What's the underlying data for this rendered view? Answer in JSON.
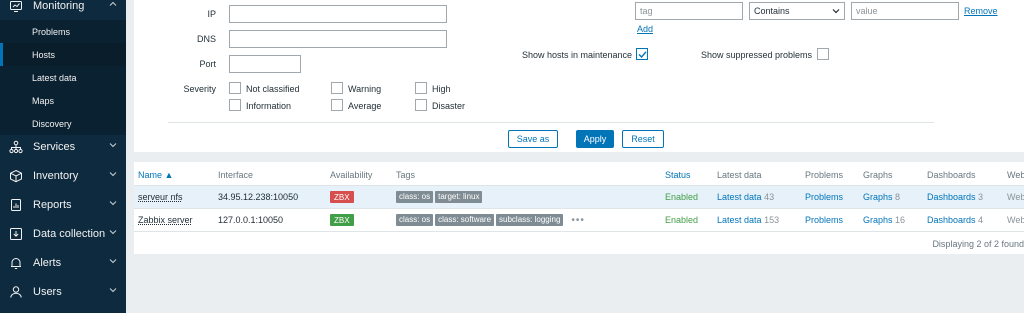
{
  "sidebar": {
    "monitoring": {
      "label": "Monitoring"
    },
    "submenu": [
      {
        "label": "Problems",
        "active": false
      },
      {
        "label": "Hosts",
        "active": true
      },
      {
        "label": "Latest data",
        "active": false
      },
      {
        "label": "Maps",
        "active": false
      },
      {
        "label": "Discovery",
        "active": false
      }
    ],
    "sections": [
      {
        "label": "Services",
        "icon": "services-icon"
      },
      {
        "label": "Inventory",
        "icon": "inventory-icon"
      },
      {
        "label": "Reports",
        "icon": "reports-icon"
      },
      {
        "label": "Data collection",
        "icon": "data-collection-icon"
      },
      {
        "label": "Alerts",
        "icon": "alerts-icon"
      },
      {
        "label": "Users",
        "icon": "users-icon"
      }
    ]
  },
  "filter": {
    "ip_label": "IP",
    "ip_value": "",
    "dns_label": "DNS",
    "dns_value": "",
    "port_label": "Port",
    "port_value": "",
    "severity_label": "Severity",
    "severities": [
      {
        "label": "Not classified",
        "checked": false
      },
      {
        "label": "Warning",
        "checked": false
      },
      {
        "label": "High",
        "checked": false
      },
      {
        "label": "Information",
        "checked": false
      },
      {
        "label": "Average",
        "checked": false
      },
      {
        "label": "Disaster",
        "checked": false
      }
    ],
    "tag_placeholder": "tag",
    "tag_operator": "Contains",
    "value_placeholder": "value",
    "remove_label": "Remove",
    "add_label": "Add",
    "show_maintenance_label": "Show hosts in maintenance",
    "show_maintenance_checked": true,
    "show_suppressed_label": "Show suppressed problems",
    "show_suppressed_checked": false,
    "save_as_label": "Save as",
    "apply_label": "Apply",
    "reset_label": "Reset"
  },
  "table": {
    "columns": [
      "Name ▲",
      "Interface",
      "Availability",
      "Tags",
      "Status",
      "Latest data",
      "Problems",
      "Graphs",
      "Dashboards",
      "Web"
    ],
    "rows": [
      {
        "name": "serveur nfs",
        "interface": "34.95.12.238:10050",
        "availability": "ZBX",
        "availability_color": "#d64e4e",
        "tags": [
          "class: os",
          "target: linux"
        ],
        "status": "Enabled",
        "latest_data": "Latest data",
        "latest_count": "43",
        "problems": "Problems",
        "graphs": "Graphs",
        "graphs_count": "8",
        "dashboards": "Dashboards",
        "dashboards_count": "3",
        "web": "Web"
      },
      {
        "name": "Zabbix server",
        "interface": "127.0.0.1:10050",
        "availability": "ZBX",
        "availability_color": "#429e47",
        "tags": [
          "class: os",
          "class: software",
          "subclass: logging"
        ],
        "tags_more": "•••",
        "status": "Enabled",
        "latest_data": "Latest data",
        "latest_count": "153",
        "problems": "Problems",
        "graphs": "Graphs",
        "graphs_count": "16",
        "dashboards": "Dashboards",
        "dashboards_count": "4",
        "web": "Web"
      }
    ],
    "footer": "Displaying 2 of 2 found"
  }
}
